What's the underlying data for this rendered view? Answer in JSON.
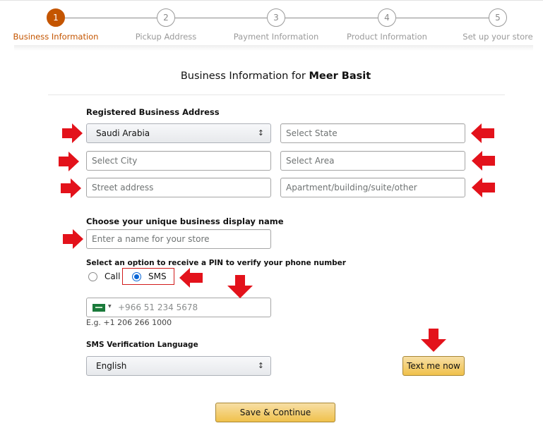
{
  "stepper": {
    "steps": [
      {
        "number": "1",
        "label": "Business Information",
        "active": true
      },
      {
        "number": "2",
        "label": "Pickup Address",
        "active": false
      },
      {
        "number": "3",
        "label": "Payment Information",
        "active": false
      },
      {
        "number": "4",
        "label": "Product Information",
        "active": false
      },
      {
        "number": "5",
        "label": "Set up your store",
        "active": false
      }
    ]
  },
  "header": {
    "title_prefix": "Business Information for",
    "user_name": "Meer Basit"
  },
  "address": {
    "section_label": "Registered Business Address",
    "country_value": "Saudi Arabia",
    "state_placeholder": "Select State",
    "city_placeholder": "Select City",
    "area_placeholder": "Select Area",
    "street_placeholder": "Street address",
    "apartment_placeholder": "Apartment/building/suite/other"
  },
  "display_name": {
    "label": "Choose your unique business display name",
    "placeholder": "Enter a name for your store"
  },
  "pin": {
    "label": "Select an option to receive a PIN to verify your phone number",
    "options": [
      {
        "label": "Call",
        "checked": false
      },
      {
        "label": "SMS",
        "checked": true
      }
    ]
  },
  "phone": {
    "country_flag": "saudi-arabia-flag",
    "placeholder": "+966 51 234 5678",
    "hint": "E.g. +1 206 266 1000"
  },
  "sms_language": {
    "label": "SMS Verification Language",
    "value": "English"
  },
  "buttons": {
    "text_me_now": "Text me now",
    "save_continue": "Save & Continue"
  },
  "colors": {
    "active_step": "#c45500",
    "annotation_arrow": "#e3121b",
    "button_primary": "#f0c14b",
    "radio_checked": "#0a66d6"
  }
}
